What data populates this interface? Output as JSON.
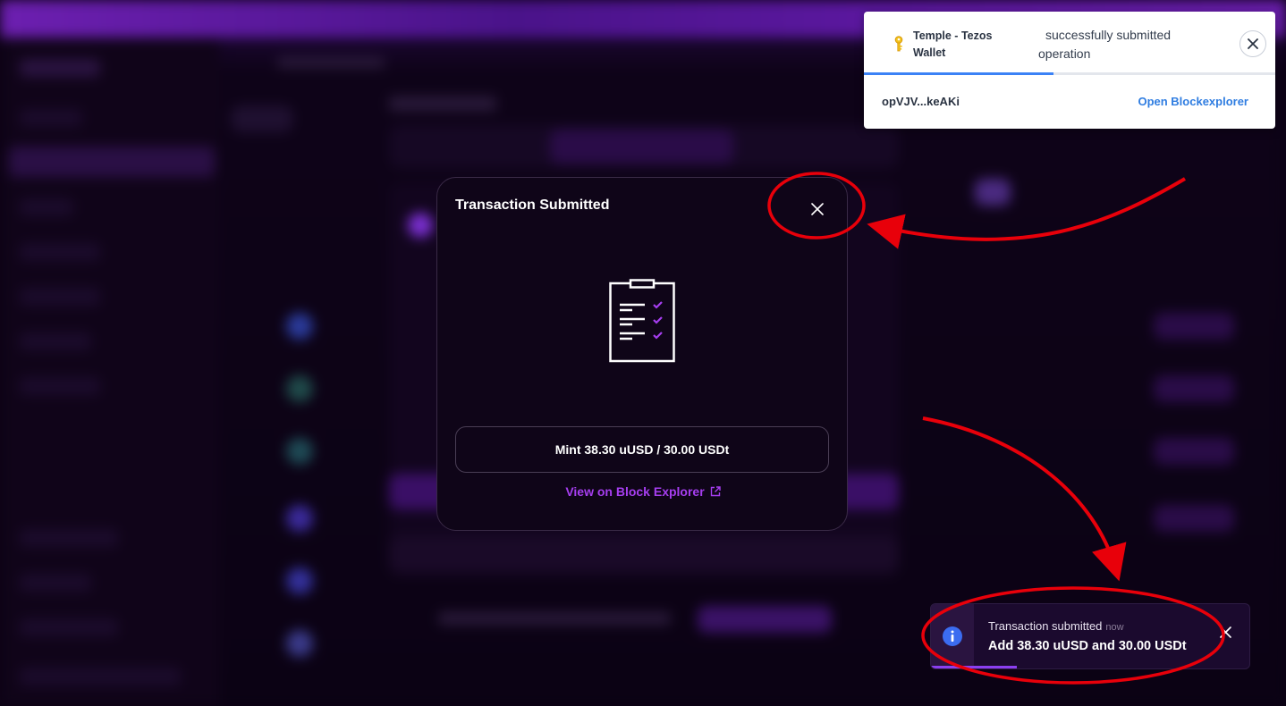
{
  "modal": {
    "title": "Transaction Submitted",
    "close_icon": "close-icon",
    "illustration_icon": "clipboard-checklist-icon",
    "summary": "Mint 38.30 uUSD / 30.00 USDt",
    "explorer_link": "View on Block Explorer",
    "explorer_icon": "external-link-icon",
    "accent_color": "#a63ef0"
  },
  "wallet_notification": {
    "app_name": "Temple - Tezos Wallet",
    "app_icon": "key-icon",
    "message": "successfully submitted operation",
    "operation_hash": "opVJV...keAKi",
    "link": "Open Blockexplorer",
    "close_icon": "close-circle-icon",
    "progress_fraction": 0.46,
    "link_color": "#2f7de1"
  },
  "toast": {
    "title": "Transaction submitted",
    "time": "now",
    "message": "Add 38.30 uUSD and 30.00 USDt",
    "info_icon": "info-icon",
    "close_icon": "close-icon",
    "progress_fraction": 0.27,
    "progress_color": "#8b3ff0"
  },
  "annotations": {
    "color": "#e8000a",
    "shapes": [
      "ellipse-around-modal-close",
      "arrow-from-wallet-to-modal-close",
      "arrow-to-toast",
      "ellipse-around-toast"
    ]
  }
}
